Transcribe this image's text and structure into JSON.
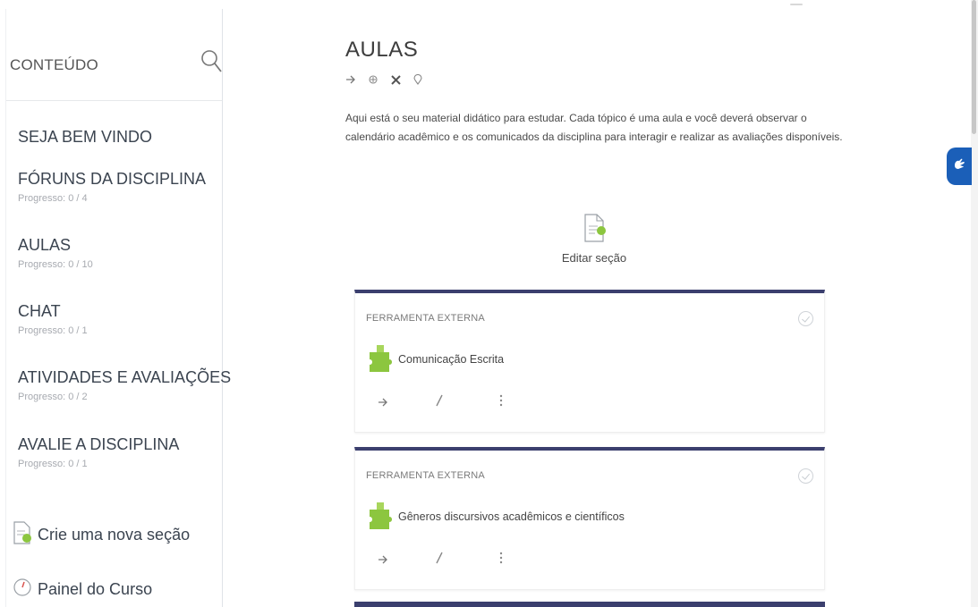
{
  "sidebar": {
    "title": "CONTEÚDO",
    "sections": [
      {
        "title": "SEJA BEM VINDO",
        "progress": ""
      },
      {
        "title": "FÓRUNS DA DISCIPLINA",
        "progress": "Progresso: 0 / 4"
      },
      {
        "title": "AULAS",
        "progress": "Progresso: 0 / 10"
      },
      {
        "title": "CHAT",
        "progress": "Progresso: 0 / 1"
      },
      {
        "title": "ATIVIDADES E AVALIAÇÕES",
        "progress": "Progresso: 0 / 2"
      },
      {
        "title": "AVALIE A DISCIPLINA",
        "progress": "Progresso: 0 / 1"
      }
    ],
    "actions": [
      {
        "label": "Crie uma nova seção",
        "icon": "new-section-icon"
      },
      {
        "label": "Painel do Curso",
        "icon": "course-panel-icon"
      }
    ]
  },
  "main": {
    "title": "AULAS",
    "toolbar_icons": [
      "arrow-right-icon",
      "move-icon",
      "close-icon",
      "pin-icon"
    ],
    "description": "Aqui está o seu material didático para estudar. Cada tópico é uma aula e você deverá observar o calendário acadêmico e os comunicados da disciplina para interagir e realizar as avaliações disponíveis.",
    "edit_section_label": "Editar seção",
    "cards": [
      {
        "type": "FERRAMENTA EXTERNA",
        "name": "Comunicação Escrita",
        "icon": "puzzle-icon"
      },
      {
        "type": "FERRAMENTA EXTERNA",
        "name": "Gêneros discursivos acadêmicos e científicos",
        "icon": "puzzle-icon"
      }
    ]
  },
  "colors": {
    "card_border": "#3b3f6e",
    "puzzle": "#8cc63f",
    "accessibility": "#1b5fb8"
  }
}
